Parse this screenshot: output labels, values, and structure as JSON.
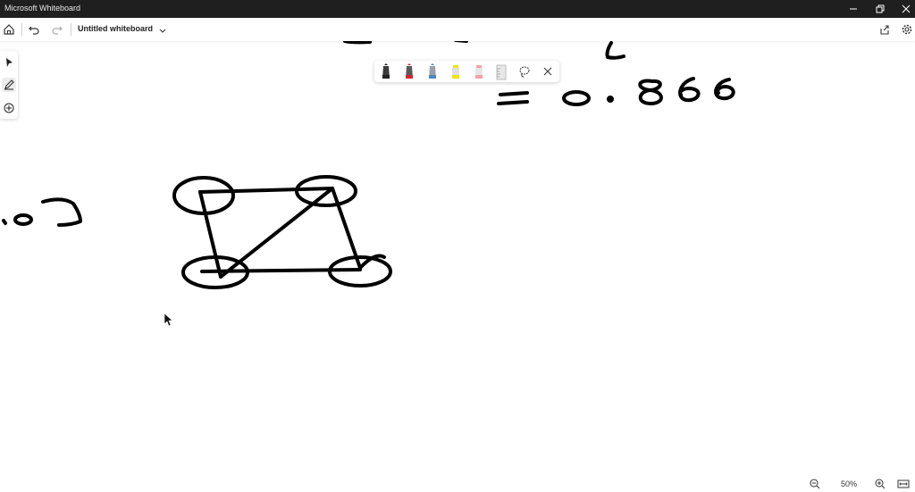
{
  "window": {
    "title": "Microsoft Whiteboard"
  },
  "toolbar": {
    "board_title": "Untitled whiteboard"
  },
  "zoom": {
    "level_label": "50%"
  },
  "canvas": {
    "handwriting": [
      "= 0.866"
    ],
    "ink_color": "#000000"
  },
  "palette": {
    "pens": [
      {
        "name": "black-pen",
        "color": "#222222"
      },
      {
        "name": "red-pen",
        "color": "#d9262c"
      },
      {
        "name": "blue-pen",
        "color": "#4a86c8"
      },
      {
        "name": "yellow-highlighter",
        "color": "#f2e600"
      },
      {
        "name": "pink-highlighter",
        "color": "#f4a0aa"
      }
    ]
  },
  "colors": {
    "titlebar": "#1f1f1f",
    "background": "#ffffff"
  }
}
